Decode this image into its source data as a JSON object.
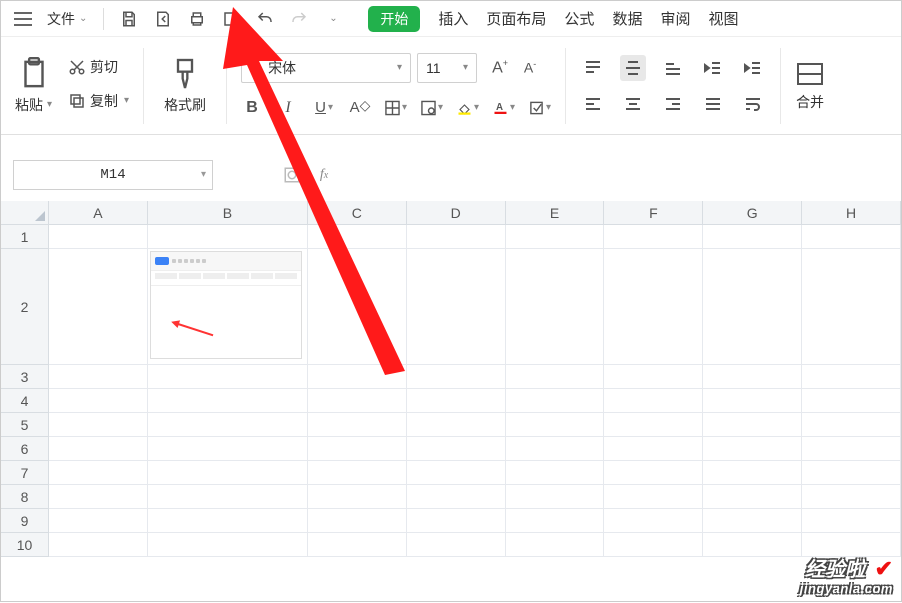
{
  "top": {
    "file_label": "文件",
    "tabs": [
      "开始",
      "插入",
      "页面布局",
      "公式",
      "数据",
      "审阅",
      "视图"
    ]
  },
  "ribbon": {
    "cut": "剪切",
    "copy": "复制",
    "paste": "粘贴",
    "format_painter": "格式刷",
    "font_name": "宋体",
    "font_size": "11",
    "merge": "合并"
  },
  "formula": {
    "name_box": "M14"
  },
  "sheet": {
    "columns": [
      "A",
      "B",
      "C",
      "D",
      "E",
      "F",
      "G",
      "H"
    ],
    "rows": [
      "1",
      "2",
      "3",
      "4",
      "5",
      "6",
      "7",
      "8",
      "9",
      "10"
    ]
  },
  "watermark": {
    "line1": "经验啦",
    "line2": "jingyanla.com"
  }
}
